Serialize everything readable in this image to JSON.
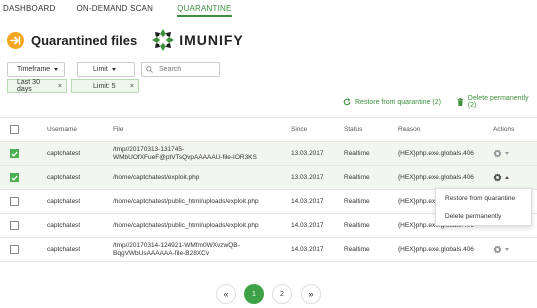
{
  "nav": {
    "tabs": [
      {
        "label": "DASHBOARD"
      },
      {
        "label": "ON-DEMAND SCAN"
      },
      {
        "label": "QUARANTINE"
      }
    ]
  },
  "header": {
    "title": "Quarantined files",
    "logo_text": "IMUNIFY",
    "brand_color": "#3c8f3c",
    "icon": "quarantine-arrow-icon"
  },
  "filters": {
    "timeframe_label": "Timeframe",
    "limit_label": "Limit",
    "search_placeholder": "Search",
    "chips": [
      {
        "label": "Last 30 days",
        "remove": "×"
      },
      {
        "label": "Limit: 5",
        "remove": "×"
      }
    ]
  },
  "actions": {
    "restore_label": "Restore from quarantine (2)",
    "delete_label": "Delete permanently (2)"
  },
  "table": {
    "headers": [
      "Username",
      "File",
      "Since",
      "Status",
      "Reason",
      "Actions"
    ],
    "rows": [
      {
        "checked": true,
        "username": "captchatest",
        "file_line1": "/tmp//20170313-131745-",
        "file_line2": "WMbUOfXFueF@ptVTsQvpAAAAAU-file-IOR3KS",
        "since": "13.03.2017",
        "status": "Realtime",
        "reason": "{HEX}php.exe.globals.406"
      },
      {
        "checked": true,
        "username": "captchatest",
        "file_line1": "/home/captchatest/exploit.php",
        "file_line2": "",
        "since": "13.03.2017",
        "status": "Realtime",
        "reason": "{HEX}php.exe.globals.406"
      },
      {
        "checked": false,
        "username": "captchatest",
        "file_line1": "/home/captchatest/public_html/uploads/exploit.php",
        "file_line2": "",
        "since": "14.03.2017",
        "status": "Realtime",
        "reason": "{HEX}php.exe.globals.406"
      },
      {
        "checked": false,
        "username": "captchatest",
        "file_line1": "/home/captchatest/public_html/uploads/exploit.php",
        "file_line2": "",
        "since": "14.03.2017",
        "status": "Realtime",
        "reason": "{HEX}php.exe.globals.406"
      },
      {
        "checked": false,
        "username": "captchatest",
        "file_line1": "/tmp//20170314-124921-WMfm0WXvzwQB-",
        "file_line2": "BqgVWbUsAAAAAA-file-B28XCv",
        "since": "14.03.2017",
        "status": "Realtime",
        "reason": "{HEX}php.exe.globals.406"
      }
    ]
  },
  "dropdown": {
    "items": [
      "Restore from quarantine",
      "Delete permanently"
    ]
  },
  "pagination": {
    "prev": "«",
    "pages": [
      "1",
      "2"
    ],
    "next": "»",
    "current": "1"
  }
}
